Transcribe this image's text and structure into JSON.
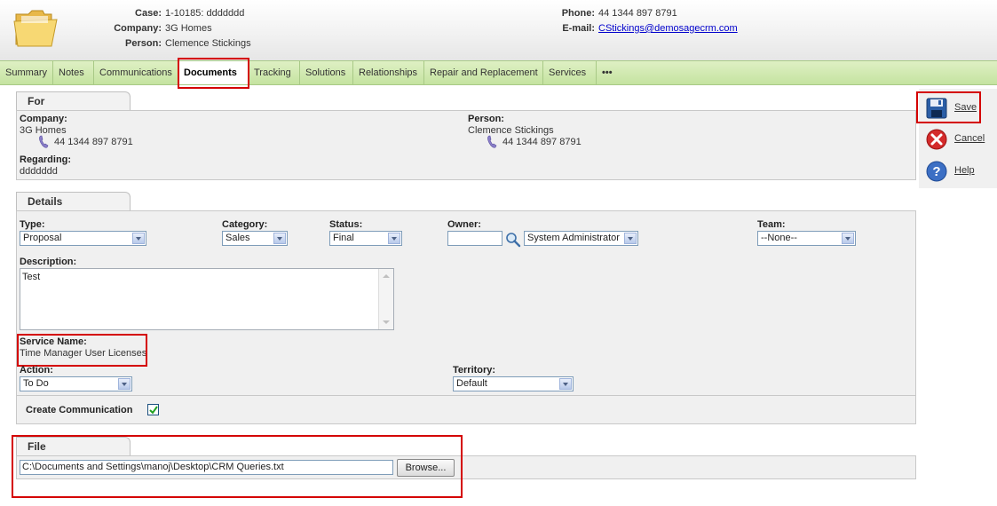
{
  "header": {
    "case_label": "Case:",
    "case_value": "1-10185: ddddddd",
    "company_label": "Company:",
    "company_value": "3G Homes",
    "person_label": "Person:",
    "person_value": "Clemence Stickings",
    "phone_label": "Phone:",
    "phone_value": "44 1344 897 8791",
    "email_label": "E-mail:",
    "email_value": "CStickings@demosagecrm.com"
  },
  "tabs": [
    {
      "label": "Summary"
    },
    {
      "label": "Notes"
    },
    {
      "label": "Communications"
    },
    {
      "label": "Documents"
    },
    {
      "label": "Tracking"
    },
    {
      "label": "Solutions"
    },
    {
      "label": "Relationships"
    },
    {
      "label": "Repair and Replacement"
    },
    {
      "label": "Services"
    },
    {
      "label": "•••"
    }
  ],
  "for_panel": {
    "title": "For",
    "company_label": "Company:",
    "company_value": "3G Homes",
    "company_phone": "44 1344 897 8791",
    "person_label": "Person:",
    "person_value": "Clemence Stickings",
    "person_phone": "44 1344 897 8791",
    "regarding_label": "Regarding:",
    "regarding_value": "ddddddd"
  },
  "details": {
    "title": "Details",
    "type_label": "Type:",
    "type_value": "Proposal",
    "category_label": "Category:",
    "category_value": "Sales",
    "status_label": "Status:",
    "status_value": "Final",
    "owner_label": "Owner:",
    "owner_input": "",
    "owner_value": "System Administrator",
    "team_label": "Team:",
    "team_value": "--None--",
    "description_label": "Description:",
    "description_value": "Test",
    "service_name_label": "Service Name:",
    "service_name_value": "Time Manager User Licenses",
    "action_label": "Action:",
    "action_value": "To Do",
    "territory_label": "Territory:",
    "territory_value": "Default",
    "create_comm_label": "Create Communication",
    "create_comm_checked": true
  },
  "file_panel": {
    "title": "File",
    "path": "C:\\Documents and Settings\\manoj\\Desktop\\CRM Queries.txt",
    "browse_label": "Browse..."
  },
  "actions": {
    "save": "Save",
    "cancel": "Cancel",
    "help": "Help"
  },
  "colors": {
    "highlight": "#d40000",
    "tabbar": "#c5e3a0",
    "panel": "#f0f0f0"
  }
}
